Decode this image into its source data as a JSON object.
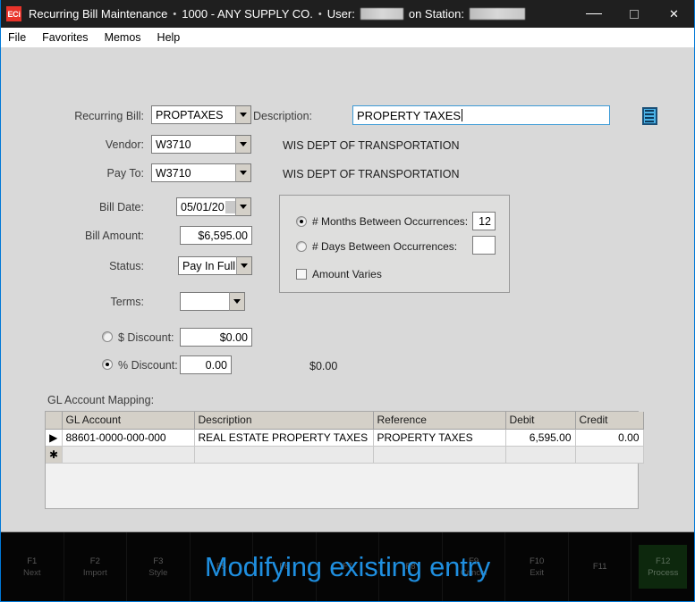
{
  "window": {
    "app_icon_text": "ECi",
    "title": "Recurring Bill Maintenance",
    "company": "1000 - ANY SUPPLY CO.",
    "user_label": "User:",
    "station_label": "on Station:",
    "separator": "•",
    "minimize_icon": "minimize-icon",
    "maximize_icon": "maximize-icon",
    "close_icon": "close-icon",
    "close_glyph": "✕"
  },
  "menubar": {
    "items": [
      {
        "label": "File"
      },
      {
        "label": "Favorites"
      },
      {
        "label": "Memos"
      },
      {
        "label": "Help"
      }
    ]
  },
  "form": {
    "recurring_bill": {
      "label": "Recurring Bill:",
      "value": "PROPTAXES"
    },
    "vendor": {
      "label": "Vendor:",
      "value": "W3710",
      "name": "WIS DEPT OF TRANSPORTATION"
    },
    "pay_to": {
      "label": "Pay To:",
      "value": "W3710",
      "name": "WIS DEPT OF TRANSPORTATION"
    },
    "bill_date": {
      "label": "Bill Date:",
      "value": "05/01/20"
    },
    "bill_amount": {
      "label": "Bill Amount:",
      "value": "$6,595.00"
    },
    "status": {
      "label": "Status:",
      "value": "Pay In Full"
    },
    "terms": {
      "label": "Terms:",
      "value": ""
    },
    "dollar_discount": {
      "label": "$ Discount:",
      "value": "$0.00",
      "selected": false
    },
    "percent_discount": {
      "label": "% Discount:",
      "value": "0.00",
      "selected": true
    },
    "discount_total": "$0.00",
    "description": {
      "label": "Description:",
      "value": "PROPERTY TAXES"
    },
    "notes_button_icon": "notes-list-icon"
  },
  "occurrences": {
    "months_between": {
      "label": "# Months Between Occurrences:",
      "value": "12",
      "selected": true
    },
    "days_between": {
      "label": "# Days Between Occurrences:",
      "value": "",
      "selected": false
    },
    "amount_varies": {
      "label": "Amount Varies",
      "checked": false
    }
  },
  "gl_mapping": {
    "section_label": "GL Account Mapping:",
    "columns": [
      "GL Account",
      "Description",
      "Reference",
      "Debit",
      "Credit"
    ],
    "rows": [
      {
        "indicator": "▶",
        "gl_account": "88601-0000-000-000",
        "description": "REAL ESTATE PROPERTY TAXES",
        "reference": "PROPERTY TAXES",
        "debit": "6,595.00",
        "credit": "0.00"
      }
    ],
    "new_row_indicator": "✱"
  },
  "function_bar": {
    "status_message": "Modifying existing entry",
    "keys": [
      {
        "num": "F1",
        "label": "Next"
      },
      {
        "num": "F2",
        "label": "Import"
      },
      {
        "num": "F3",
        "label": "Style"
      },
      {
        "num": "F5",
        "label": ""
      },
      {
        "num": "F6",
        "label": ""
      },
      {
        "num": "F7",
        "label": ""
      },
      {
        "num": "F8",
        "label": ""
      },
      {
        "num": "F9",
        "label": "Cancel"
      },
      {
        "num": "F10",
        "label": "Exit"
      },
      {
        "num": "F11",
        "label": ""
      },
      {
        "num": "F12",
        "label": "Process"
      }
    ]
  },
  "colors": {
    "titlebar": "#1f1f1f",
    "window_border": "#0078d7",
    "client_bg": "#d9d9d9",
    "accent_blue": "#1f8fe0",
    "focus_border": "#3c9ad6",
    "process_green": "#0d280d",
    "icon_red": "#e8332a",
    "notes_blue": "#4bb3e8"
  }
}
